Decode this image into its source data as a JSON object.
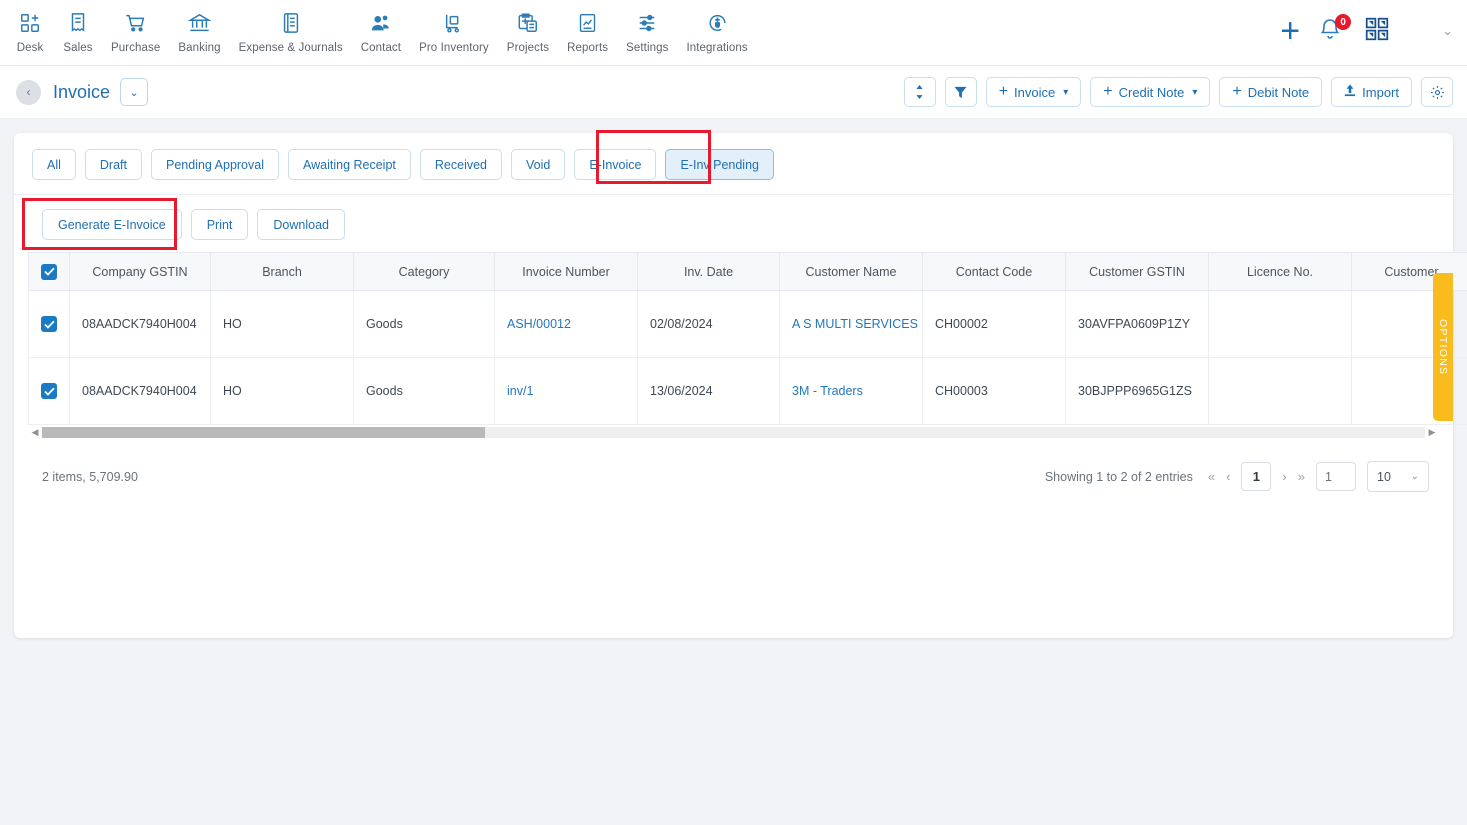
{
  "topnav": {
    "items": [
      {
        "label": "Desk",
        "icon": "desk-icon"
      },
      {
        "label": "Sales",
        "icon": "sales-icon"
      },
      {
        "label": "Purchase",
        "icon": "purchase-cart-icon"
      },
      {
        "label": "Banking",
        "icon": "bank-icon"
      },
      {
        "label": "Expense & Journals",
        "icon": "journal-icon"
      },
      {
        "label": "Contact",
        "icon": "contact-people-icon"
      },
      {
        "label": "Pro Inventory",
        "icon": "inventory-trolley-icon"
      },
      {
        "label": "Projects",
        "icon": "projects-clipboard-icon"
      },
      {
        "label": "Reports",
        "icon": "reports-chart-icon"
      },
      {
        "label": "Settings",
        "icon": "settings-sliders-icon"
      },
      {
        "label": "Integrations",
        "icon": "integrations-plug-icon"
      }
    ],
    "add_label": "+",
    "notification_count": "0",
    "apps_label": "apps-grid",
    "user_caret": "⌄"
  },
  "titlebar": {
    "back": "‹",
    "title": "Invoice",
    "title_caret": "⌄",
    "actions": {
      "sort_icon": "↕",
      "filter_icon": "▼",
      "invoice": "Invoice",
      "credit_note": "Credit Note",
      "debit_note": "Debit Note",
      "import": "Import",
      "settings_icon": "gear"
    }
  },
  "tabs": [
    {
      "label": "All",
      "active": false
    },
    {
      "label": "Draft",
      "active": false
    },
    {
      "label": "Pending Approval",
      "active": false
    },
    {
      "label": "Awaiting Receipt",
      "active": false
    },
    {
      "label": "Received",
      "active": false
    },
    {
      "label": "Void",
      "active": false
    },
    {
      "label": "E-Invoice",
      "active": false
    },
    {
      "label": "E-Inv Pending",
      "active": true
    }
  ],
  "actions": {
    "generate": "Generate E-Invoice",
    "print": "Print",
    "download": "Download"
  },
  "table": {
    "columns": [
      "Company GSTIN",
      "Branch",
      "Category",
      "Invoice Number",
      "Inv. Date",
      "Customer Name",
      "Contact Code",
      "Customer GSTIN",
      "Licence No.",
      "Customer"
    ],
    "rows": [
      {
        "checked": true,
        "company_gstin": "08AADCK7940H004",
        "branch": "HO",
        "category": "Goods",
        "invoice_number": "ASH/00012",
        "inv_date": "02/08/2024",
        "customer_name": "A S MULTI SERVICES",
        "contact_code": "CH00002",
        "customer_gstin": "30AVFPA0609P1ZY",
        "licence_no": "",
        "customer": ""
      },
      {
        "checked": true,
        "company_gstin": "08AADCK7940H004",
        "branch": "HO",
        "category": "Goods",
        "invoice_number": "inv/1",
        "inv_date": "13/06/2024",
        "customer_name": "3M - Traders",
        "contact_code": "CH00003",
        "customer_gstin": "30BJPPP6965G1ZS",
        "licence_no": "",
        "customer": ""
      }
    ]
  },
  "footer": {
    "items_total": "2 items, 5,709.90",
    "showing": "Showing 1 to 2 of 2 entries",
    "first": "«",
    "prev": "‹",
    "current_page": "1",
    "next": "›",
    "last": "»",
    "page_input_value": "1",
    "page_size": "10",
    "page_size_caret": "⌄"
  },
  "options_panel": {
    "label": "OPTIONS"
  },
  "colors": {
    "accent_blue": "#1f6fb2",
    "link_blue": "#2277bf",
    "checkbox_blue": "#1a7bc4",
    "highlight_red": "#e8192c",
    "options_yellow": "#f9bc1e",
    "active_tab_bg": "#e4f0f9",
    "badge_red": "#e8192c"
  }
}
